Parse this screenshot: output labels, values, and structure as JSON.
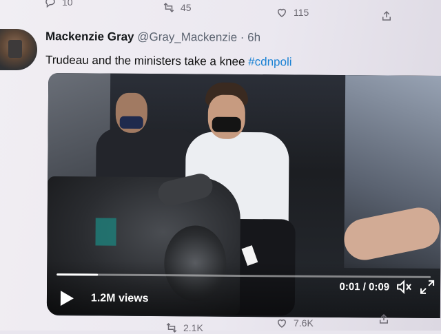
{
  "top_actions": {
    "reply_count": "10",
    "retweet_count": "45",
    "like_count": "115"
  },
  "tweet": {
    "author_name": "Mackenzie Gray",
    "author_handle": "@Gray_Mackenzie",
    "separator": "·",
    "time": "6h",
    "text": "Trudeau and the ministers take a knee",
    "hashtag": "#cdnpoli"
  },
  "video": {
    "views": "1.2M views",
    "time_display": "0:01 / 0:09",
    "progress_fraction": 0.11
  },
  "bottom_actions": {
    "retweet_count": "2.1K",
    "like_count": "7.6K"
  },
  "colors": {
    "hashtag": "#1b82d4",
    "background": "#ebe8f0"
  },
  "icons": [
    "reply-icon",
    "retweet-icon",
    "like-icon",
    "share-icon",
    "play-icon",
    "mute-icon",
    "fullscreen-icon"
  ]
}
